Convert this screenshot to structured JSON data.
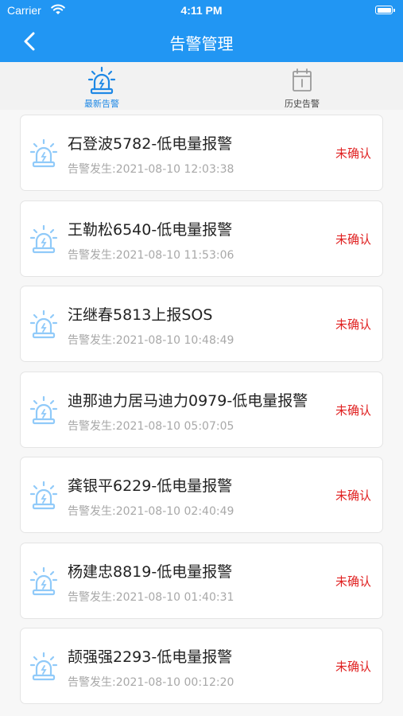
{
  "status_bar": {
    "carrier": "Carrier",
    "time": "4:11 PM"
  },
  "nav": {
    "title": "告警管理",
    "back_icon": "chevron-left-icon"
  },
  "tabs": [
    {
      "label": "最新告警",
      "icon": "alarm-light-icon",
      "active": true
    },
    {
      "label": "历史告警",
      "icon": "calendar-icon",
      "active": false
    }
  ],
  "colors": {
    "primary": "#2196f3",
    "unconfirmed": "#e02020",
    "alarm_icon": "#90caf9"
  },
  "alarms": [
    {
      "title": "石登波5782-低电量报警",
      "time": "告警发生:2021-08-10 12:03:38",
      "status": "未确认"
    },
    {
      "title": "王勒松6540-低电量报警",
      "time": "告警发生:2021-08-10 11:53:06",
      "status": "未确认"
    },
    {
      "title": "汪继春5813上报SOS",
      "time": "告警发生:2021-08-10 10:48:49",
      "status": "未确认"
    },
    {
      "title": "迪那迪力居马迪力0979-低电量报警",
      "time": "告警发生:2021-08-10 05:07:05",
      "status": "未确认"
    },
    {
      "title": "龚银平6229-低电量报警",
      "time": "告警发生:2021-08-10 02:40:49",
      "status": "未确认"
    },
    {
      "title": "杨建忠8819-低电量报警",
      "time": "告警发生:2021-08-10 01:40:31",
      "status": "未确认"
    },
    {
      "title": "颉强强2293-低电量报警",
      "time": "告警发生:2021-08-10 00:12:20",
      "status": "未确认"
    }
  ]
}
